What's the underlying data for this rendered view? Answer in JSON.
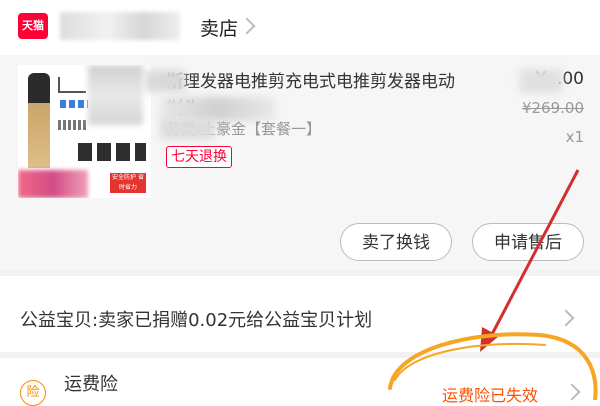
{
  "store": {
    "badge": "天猫",
    "name": "卖店"
  },
  "product": {
    "title": "斯理发器电推剪充电式电推剪发器电动剃头",
    "sku_label": "分类:土豪金【套餐一】",
    "return_badge": "七天退换",
    "price": "¥...00",
    "original_price": "¥269.00",
    "quantity": "x1",
    "image_tag": "安全防护 省时省力"
  },
  "actions": {
    "sell_label": "卖了换钱",
    "after_sale_label": "申请售后"
  },
  "charity": {
    "text": "公益宝贝:卖家已捐赠0.02元给公益宝贝计划"
  },
  "insurance": {
    "icon_char": "险",
    "title": "运费险",
    "status": "运费险已失效"
  },
  "colors": {
    "accent": "#ff0036",
    "insurance": "#ff8a00",
    "annotation_red": "#d32f2f",
    "annotation_orange": "#f5a623"
  }
}
